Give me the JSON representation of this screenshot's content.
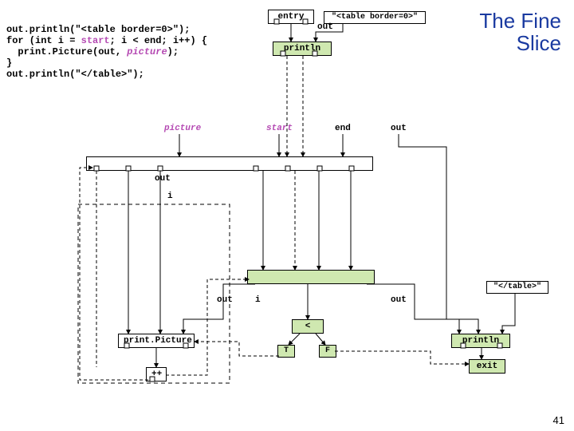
{
  "title_line1": "The Fine",
  "title_line2": "Slice",
  "page_number": "41",
  "code": {
    "l1a": "out.println(\"<table border=0>\");",
    "l2a": "for (int i = ",
    "l2b": "start",
    "l2c": "; i < end; i++) {",
    "l3a": "  print.Picture(out, ",
    "l3b": "picture",
    "l3c": ");",
    "l4": "}",
    "l5": "out.println(\"</table>\");"
  },
  "nodes": {
    "entry": "entry",
    "tbopen": "\"<table border=0>\"",
    "println1": "println",
    "printPicture": "print.Picture",
    "incr": "++",
    "lt": "<",
    "true": "T",
    "false": "F",
    "tbclose": "\"</table>\"",
    "println2": "println",
    "exit": "exit"
  },
  "labels": {
    "out1": "out",
    "picture": "picture",
    "start": "start",
    "end": "end",
    "outR": "out",
    "out2": "out",
    "i1": "i",
    "out3": "out",
    "i2": "i",
    "out4": "out"
  }
}
